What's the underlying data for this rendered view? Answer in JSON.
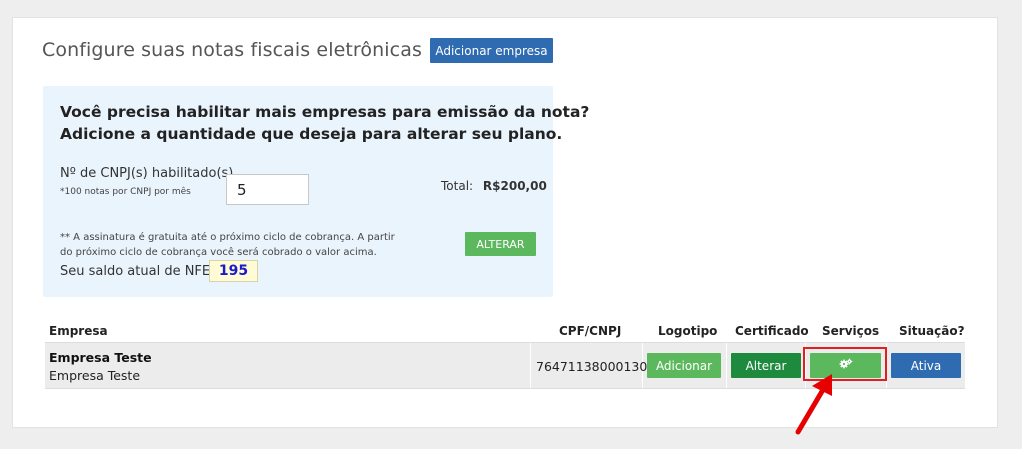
{
  "page": {
    "title": "Configure suas notas fiscais eletrônicas",
    "add_company_label": "Adicionar empresa"
  },
  "plan": {
    "heading_line1": "Você precisa habilitar mais empresas para emissão da nota?",
    "heading_line2": "Adicione a quantidade que deseja para alterar seu plano.",
    "cnpj_label": "Nº de CNPJ(s) habilitado(s)",
    "cnpj_note": "*100 notas por CNPJ por mês",
    "cnpj_value": "5",
    "total_label": "Total:",
    "total_value": "R$200,00",
    "note_line1": "** A assinatura é gratuita até o próximo ciclo de cobrança. A partir",
    "note_line2": "do próximo ciclo de cobrança você será cobrado o valor acima.",
    "alter_label": "ALTERAR",
    "balance_label": "Seu saldo atual de NFE é",
    "balance_value": "195"
  },
  "table": {
    "headers": {
      "company": "Empresa",
      "cnpj": "CPF/CNPJ",
      "logo": "Logotipo",
      "certificate": "Certificado",
      "services": "Serviços",
      "status": "Situação?"
    },
    "rows": [
      {
        "name": "Empresa Teste",
        "sub": "Empresa Teste",
        "cnpj": "76471138000130",
        "logo_action": "Adicionar",
        "certificate_action": "Alterar",
        "services_icon": "gears-icon",
        "status": "Ativa"
      }
    ]
  },
  "colors": {
    "primary": "#2f6bb1",
    "success": "#5cb85c",
    "success_dark": "#1e8a3e",
    "highlight": "#e02020",
    "info_bg": "#eaf4fd"
  }
}
